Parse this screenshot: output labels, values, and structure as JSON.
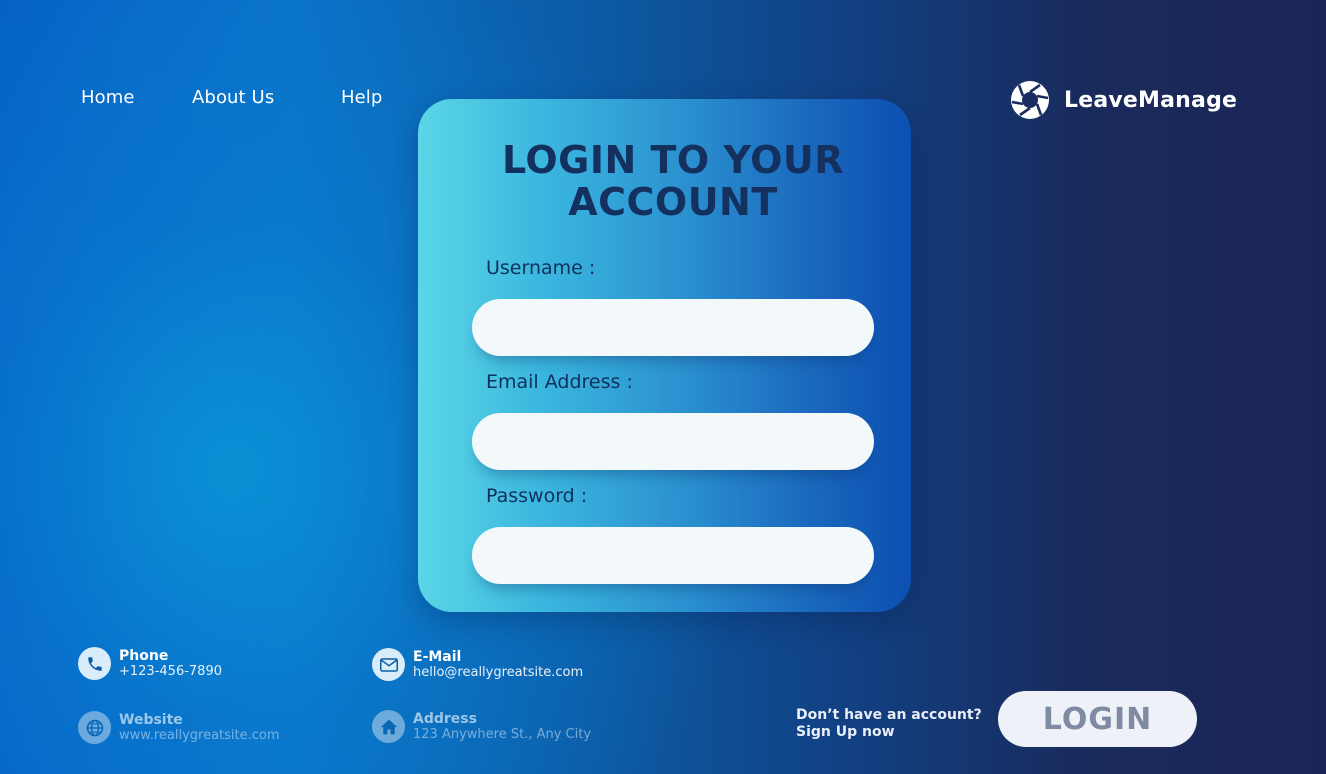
{
  "nav": {
    "home": "Home",
    "about": "About Us",
    "help": "Help"
  },
  "brand": {
    "name": "LeaveManage",
    "logo_icon": "camera-shutter-icon"
  },
  "form": {
    "title_line1": "LOGIN TO YOUR",
    "title_line2": "ACCOUNT",
    "username_label": "Username  :",
    "email_label": "Email Address  :",
    "password_label": "Password  :",
    "username_value": "",
    "email_value": "",
    "password_value": ""
  },
  "contact": {
    "phone": {
      "title": "Phone",
      "value": "+123-456-7890",
      "icon": "phone-icon"
    },
    "email": {
      "title": "E-Mail",
      "value": "hello@reallygreatsite.com",
      "icon": "mail-icon"
    },
    "website": {
      "title": "Website",
      "value": "www.reallygreatsite.com",
      "icon": "globe-icon"
    },
    "address": {
      "title": "Address",
      "value": "123 Anywhere St., Any City",
      "icon": "home-icon"
    }
  },
  "signup": {
    "question": "Don’t have an account?",
    "link": "Sign Up now"
  },
  "login_button": "LOGIN",
  "colors": {
    "title": "#14305f",
    "input_bg": "#f3f9fb",
    "button_text": "#7f8aa3"
  }
}
